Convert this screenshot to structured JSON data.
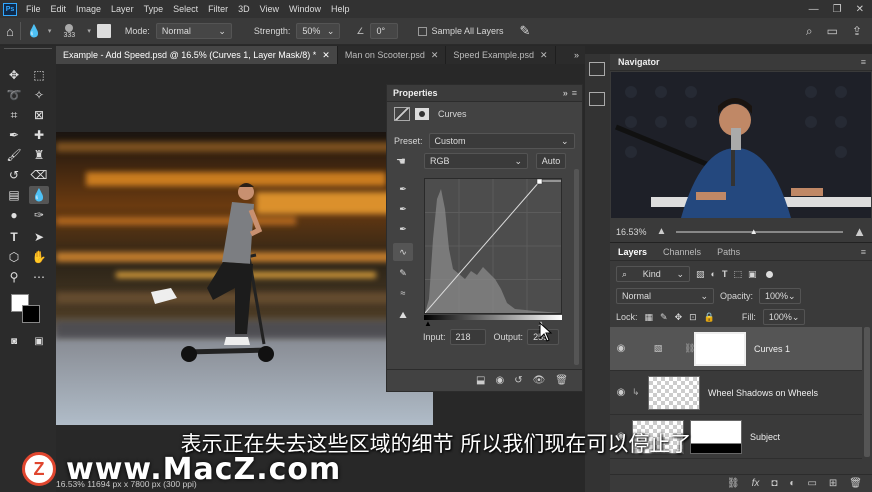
{
  "menubar": {
    "items": [
      "File",
      "Edit",
      "Image",
      "Layer",
      "Type",
      "Select",
      "Filter",
      "3D",
      "View",
      "Window",
      "Help"
    ],
    "window_controls": [
      "—",
      "❐",
      "✕"
    ]
  },
  "options": {
    "brush_size": "333",
    "mode_label": "Mode:",
    "mode_value": "Normal",
    "strength_label": "Strength:",
    "strength_value": "50%",
    "angle_value": "0°",
    "sample_all_layers": "Sample All Layers"
  },
  "tabs": [
    {
      "label": "Example - Add Speed.psd @ 16.5% (Curves 1, Layer Mask/8) *",
      "active": true
    },
    {
      "label": "Man on Scooter.psd",
      "active": false
    },
    {
      "label": "Speed Example.psd",
      "active": false
    }
  ],
  "properties": {
    "title": "Properties",
    "adjustment": "Curves",
    "preset_label": "Preset:",
    "preset_value": "Custom",
    "channel_value": "RGB",
    "auto_label": "Auto",
    "input_label": "Input:",
    "input_value": "218",
    "output_label": "Output:",
    "output_value": "255"
  },
  "navigator": {
    "title": "Navigator",
    "zoom": "16.53%"
  },
  "layers_panel": {
    "tabs": [
      "Layers",
      "Channels",
      "Paths"
    ],
    "kind_label": "Kind",
    "blend_mode": "Normal",
    "opacity_label": "Opacity:",
    "opacity_value": "100%",
    "lock_label": "Lock:",
    "fill_label": "Fill:",
    "fill_value": "100%",
    "layers": [
      {
        "name": "Curves 1"
      },
      {
        "name": "Wheel Shadows on Wheels"
      },
      {
        "name": "Subject"
      }
    ]
  },
  "status": {
    "text": "16.53% 11694 px x 7800 px (300 ppi)"
  },
  "subtitle": "表示正在失去这些区域的细节 所以我们现在可以停止了",
  "watermark": {
    "logo": "Z",
    "text": "www.MacZ.com"
  },
  "colors": {
    "accent": "#31a8ff",
    "panel": "#424242",
    "background": "#282828"
  }
}
